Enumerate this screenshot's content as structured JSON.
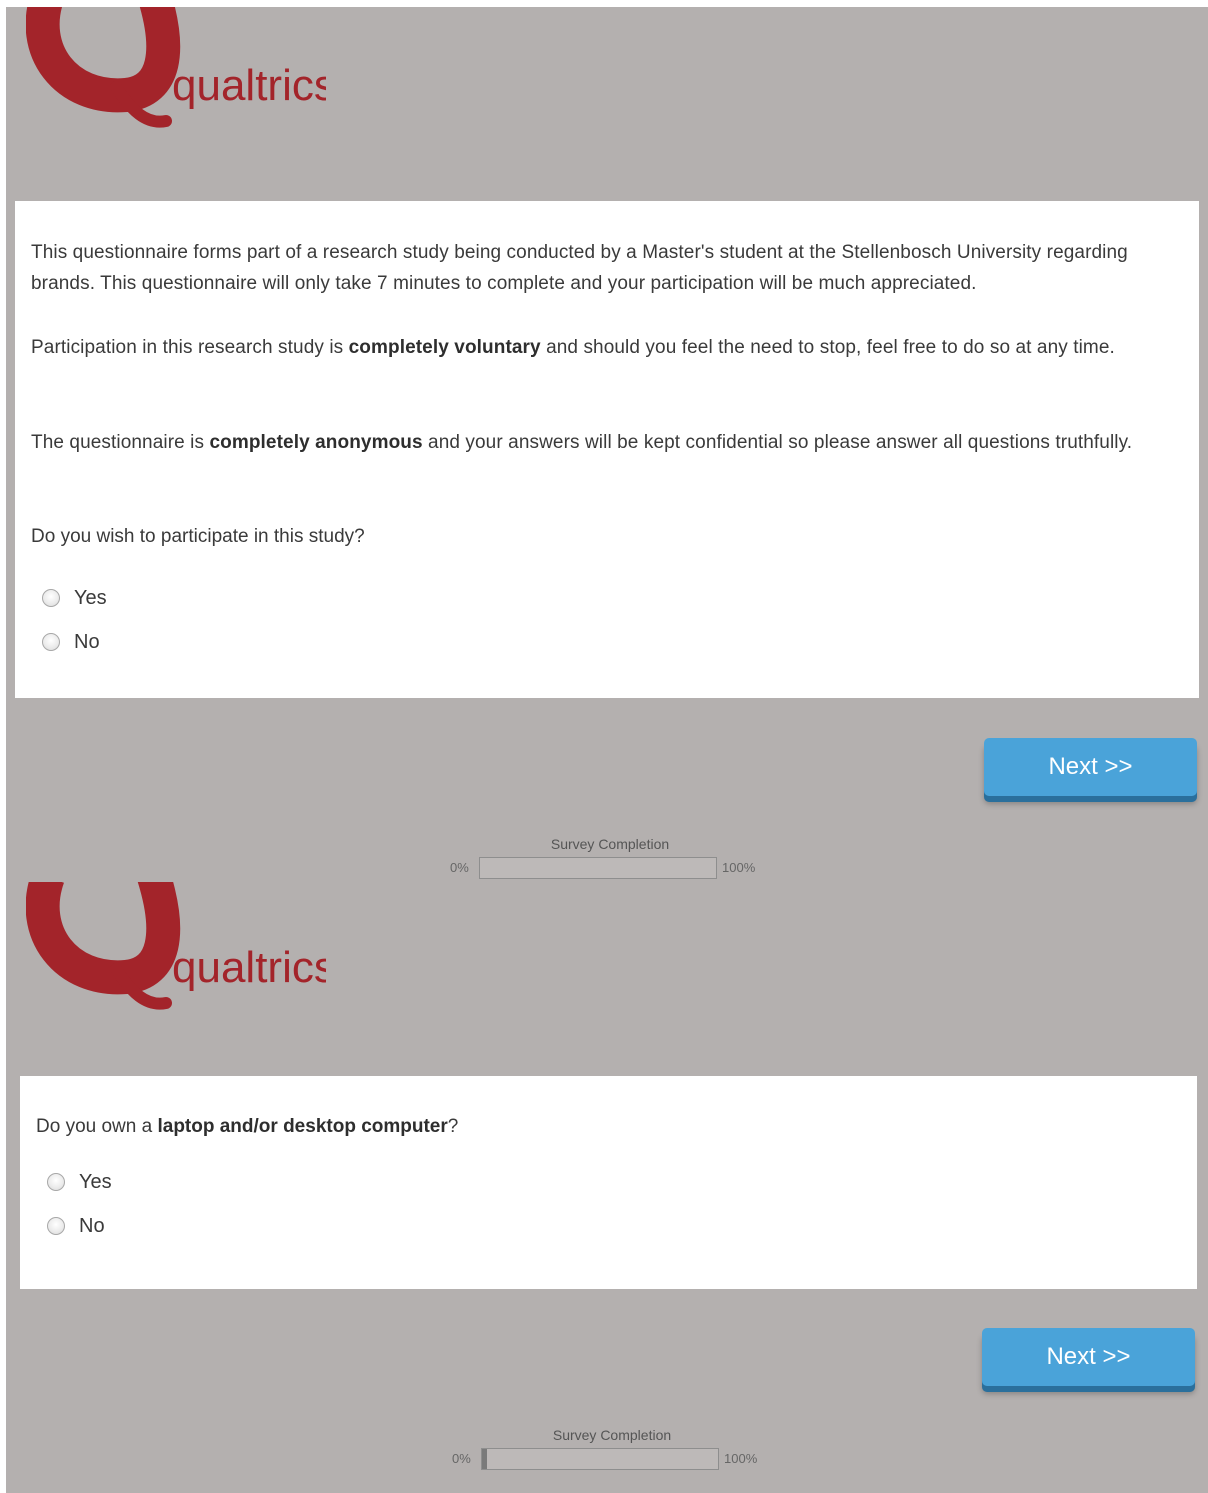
{
  "brand": {
    "name": "qualtrics",
    "color": "#a3242a"
  },
  "pages": [
    {
      "intro_paragraphs": [
        {
          "text": "This questionnaire forms part of a research study being conducted by a Master's student at the Stellenbosch University regarding brands. This questionnaire will only take 7 minutes to complete and your participation will be much appreciated."
        },
        {
          "before": "Participation in this research study is ",
          "bold": "completely voluntary",
          "after": " and should you feel the need to stop, feel free to do so at any time."
        },
        {
          "before": "The questionnaire is ",
          "bold": "completely anonymous",
          "after": " and your answers will be kept confidential so please answer all questions truthfully."
        }
      ],
      "question": {
        "before": "Do you wish to participate in this study?",
        "bold": "",
        "after": ""
      },
      "options": [
        "Yes",
        "No"
      ],
      "next_label": "Next >>",
      "progress": {
        "title": "Survey Completion",
        "min_label": "0%",
        "max_label": "100%",
        "fraction": 0
      }
    },
    {
      "question": {
        "before": "Do you own a ",
        "bold": "laptop and/or desktop computer",
        "after": "?"
      },
      "options": [
        "Yes",
        "No"
      ],
      "next_label": "Next >>",
      "progress": {
        "title": "Survey Completion",
        "min_label": "0%",
        "max_label": "100%",
        "fraction": 0.02
      }
    }
  ],
  "colors": {
    "page_background": "#b4b0af",
    "button": "#4aa3d9",
    "button_shadow": "#2a6f9c"
  }
}
